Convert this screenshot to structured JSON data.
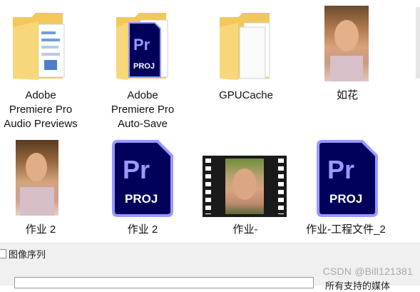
{
  "files": [
    {
      "type": "folder-doc",
      "lines": [
        "Adobe",
        "Premiere Pro",
        "Audio Previews"
      ]
    },
    {
      "type": "folder-pr",
      "lines": [
        "Adobe",
        "Premiere Pro",
        "Auto-Save"
      ]
    },
    {
      "type": "folder-plain",
      "lines": [
        "GPUCache"
      ]
    },
    {
      "type": "image",
      "lines": [
        "如花"
      ]
    },
    {
      "type": "image",
      "lines": [
        "作业 2"
      ]
    },
    {
      "type": "pr-project",
      "lines": [
        "作业 2"
      ]
    },
    {
      "type": "video",
      "lines": [
        "作业-"
      ]
    },
    {
      "type": "pr-project",
      "lines": [
        "作业-工程文件_2"
      ]
    }
  ],
  "pr_icon": {
    "letters": "Pr",
    "ext": "PROJ"
  },
  "bottom": {
    "image_sequence_label": "图像序列",
    "clipped_text": "所有支持的媒体"
  },
  "watermark": "CSDN @Bill121381",
  "colors": {
    "pr_bg": "#00005b",
    "pr_border": "#9999ff",
    "folder": "#f7d774",
    "folder_dark": "#e4b847"
  }
}
